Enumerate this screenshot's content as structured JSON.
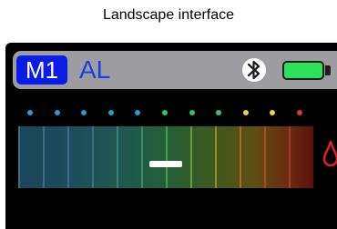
{
  "page": {
    "title": "Landscape interface"
  },
  "status_bar": {
    "mode_badge": "M1",
    "mode_text": "AL",
    "bluetooth_icon": "bluetooth-icon",
    "battery_icon": "battery-icon",
    "battery_level": 1.0
  },
  "indicator_dots": {
    "count": 11,
    "colors": [
      "#1e9fd8",
      "#1e9fd8",
      "#1e9fd8",
      "#1e9fd8",
      "#1e9fd8",
      "#2cc86a",
      "#2cc86a",
      "#2cc86a",
      "#f0d13a",
      "#f0d13a",
      "#e8323a"
    ]
  },
  "meter": {
    "segments": 12,
    "tick_colors": [
      "#3a6f8c",
      "#3a6f8c",
      "#3a6f8c",
      "#3a6f8c",
      "#3a7f7a",
      "#3d8a55",
      "#4a9a4c",
      "#6f9a3c",
      "#9a8a2a",
      "#a96a22",
      "#b04a24",
      "#a33a2a"
    ],
    "marker_position": 0.5,
    "drop_icon": "drop-icon",
    "drop_color": "#e0202a"
  },
  "colors": {
    "badge_bg": "#0c1ce8",
    "mode_text": "#1a3fe0",
    "status_bar_bg": "#9d9da1",
    "battery_fill": "#2de05a"
  }
}
